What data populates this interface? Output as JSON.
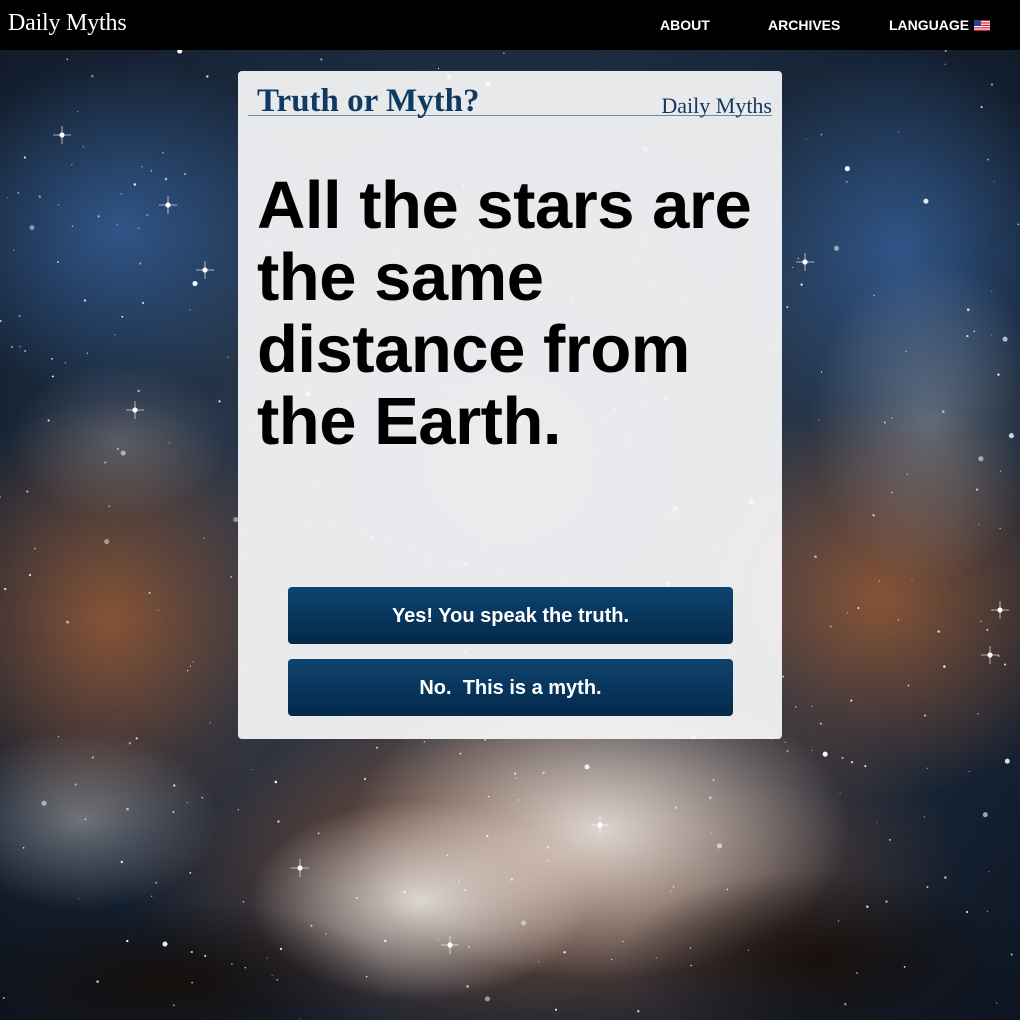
{
  "brand": "Daily Myths",
  "nav": {
    "about": "ABOUT",
    "archives": "ARCHIVES",
    "language": "LANGUAGE",
    "language_flag_icon": "us-flag-icon"
  },
  "card": {
    "title": "Truth or Myth?",
    "brand": "Daily Myths",
    "statement": "All the stars are the same distance from the Earth.",
    "buttons": {
      "truth": "Yes! You speak the truth.",
      "myth": "No.  This is a myth."
    }
  },
  "colors": {
    "topbar": "#000000",
    "title": "#0f3a63",
    "button_top": "#0e4470",
    "button_bottom": "#03294a",
    "background": "nebula starfield"
  }
}
